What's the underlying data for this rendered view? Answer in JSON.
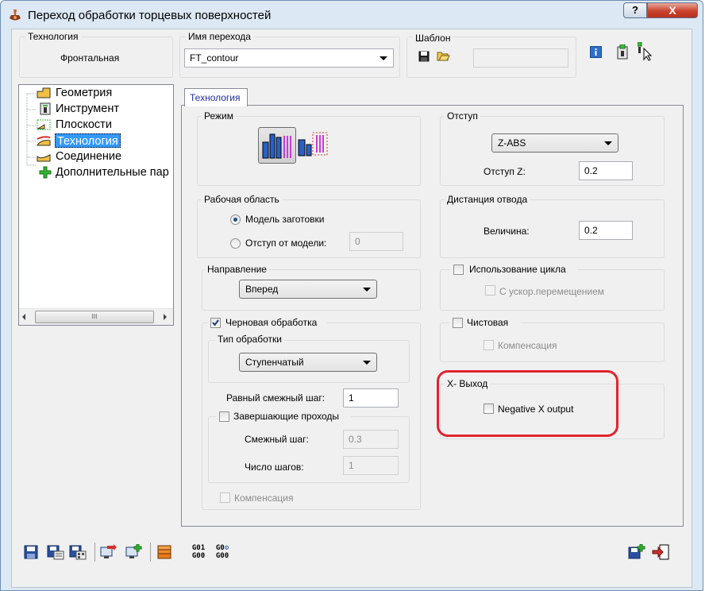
{
  "window": {
    "title": "Переход обработки торцевых поверхностей",
    "help_label": "?",
    "close_label": "X"
  },
  "header": {
    "technology_label": "Технология",
    "technology_value": "Фронтальная",
    "pass_name_label": "Имя перехода",
    "pass_name_value": "FT_contour",
    "template_label": "Шаблон",
    "template_value": ""
  },
  "tree": {
    "items": [
      {
        "label": "Геометрия",
        "icon": "geometry-icon"
      },
      {
        "label": "Инструмент",
        "icon": "tool-icon"
      },
      {
        "label": "Плоскости",
        "icon": "planes-icon"
      },
      {
        "label": "Технология",
        "icon": "technology-icon",
        "selected": true
      },
      {
        "label": "Соединение",
        "icon": "connection-icon"
      },
      {
        "label": "Дополнительные пар",
        "icon": "add-icon"
      }
    ],
    "scroll_thumb": "III"
  },
  "tab": {
    "label": "Технология"
  },
  "mode": {
    "label": "Режим"
  },
  "work_area": {
    "label": "Рабочая область",
    "option1": "Модель заготовки",
    "option2": "Отступ от модели:",
    "offset_value": "0"
  },
  "direction": {
    "label": "Направление",
    "value": "Вперед"
  },
  "rough": {
    "label": "Черновая обработка",
    "checked": true,
    "type_label": "Тип обработки",
    "type_value": "Ступенчатый",
    "step_label": "Равный смежный шаг:",
    "step_value": "1",
    "finish_passes_label": "Завершающие проходы",
    "adj_step_label": "Смежный шаг:",
    "adj_step_value": "0.3",
    "num_steps_label": "Число шагов:",
    "num_steps_value": "1",
    "compensation_label": "Компенсация"
  },
  "offset": {
    "label": "Отступ",
    "combo_value": "Z-ABS",
    "z_label": "Отступ Z:",
    "z_value": "0.2"
  },
  "retract": {
    "label": "Дистанция отвода",
    "value_label": "Величина:",
    "value": "0.2"
  },
  "cycle": {
    "label": "Использование цикла",
    "sub_label": "С ускор.перемещением"
  },
  "finish": {
    "label": "Чистовая",
    "compensation_label": "Компенсация"
  },
  "x_output": {
    "label": "X- Выход",
    "negative_label": "Negative X output"
  },
  "toolbar": {
    "g01_top": "G01",
    "g01_bottom": "G00",
    "g0_top": "G0",
    "g0_bottom": "G00"
  },
  "colors": {
    "accent": "#1b4f8e",
    "highlight_ring": "#e0242d",
    "tab_text": "#1f2fa8",
    "selection": "#3399ff"
  }
}
